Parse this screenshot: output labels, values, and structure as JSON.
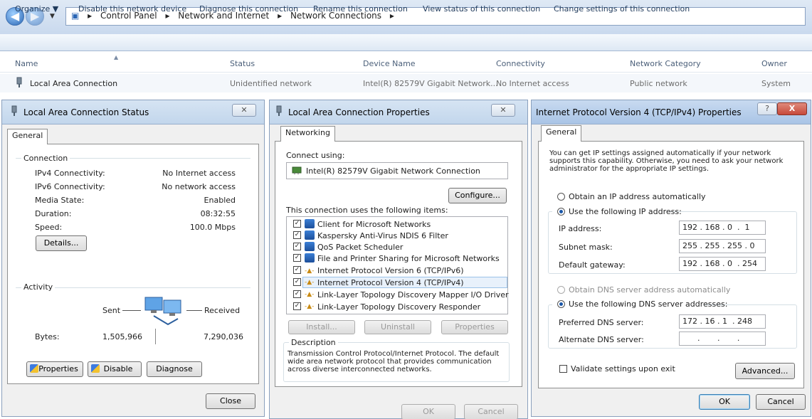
{
  "window": {
    "breadcrumbs": [
      "Control Panel",
      "Network and Internet",
      "Network Connections"
    ]
  },
  "toolbar": {
    "organize": "Organize ▼",
    "disable": "Disable this network device",
    "diagnose": "Diagnose this connection",
    "rename": "Rename this connection",
    "view_status": "View status of this connection",
    "change_settings": "Change settings of this connection"
  },
  "list": {
    "columns": [
      "Name",
      "Status",
      "Device Name",
      "Connectivity",
      "Network Category",
      "Owner"
    ],
    "rows": [
      [
        "Local Area Connection",
        "Unidentified network",
        "Intel(R) 82579V Gigabit Network...",
        "No Internet access",
        "Public network",
        "System"
      ]
    ]
  },
  "status_dialog": {
    "title": "Local Area Connection Status",
    "tab": "General",
    "connection_group": "Connection",
    "fields": [
      {
        "label": "IPv4 Connectivity:",
        "value": "No Internet access"
      },
      {
        "label": "IPv6 Connectivity:",
        "value": "No network access"
      },
      {
        "label": "Media State:",
        "value": "Enabled"
      },
      {
        "label": "Duration:",
        "value": "08:32:55"
      },
      {
        "label": "Speed:",
        "value": "100.0 Mbps"
      }
    ],
    "details_btn": "Details...",
    "activity_group": "Activity",
    "sent": "Sent",
    "received": "Received",
    "bytes_label": "Bytes:",
    "bytes_sent": "1,505,966",
    "bytes_received": "7,290,036",
    "properties_btn": "Properties",
    "disable_btn": "Disable",
    "diagnose_btn": "Diagnose",
    "close_btn": "Close"
  },
  "props_dialog": {
    "title": "Local Area Connection Properties",
    "tab": "Networking",
    "connect_using": "Connect using:",
    "adapter": "Intel(R) 82579V Gigabit Network Connection",
    "configure_btn": "Configure...",
    "items_label": "This connection uses the following items:",
    "items": [
      "Client for Microsoft Networks",
      "Kaspersky Anti-Virus NDIS 6 Filter",
      "QoS Packet Scheduler",
      "File and Printer Sharing for Microsoft Networks",
      "Internet Protocol Version 6 (TCP/IPv6)",
      "Internet Protocol Version 4 (TCP/IPv4)",
      "Link-Layer Topology Discovery Mapper I/O Driver",
      "Link-Layer Topology Discovery Responder"
    ],
    "install_btn": "Install...",
    "uninstall_btn": "Uninstall",
    "properties_btn": "Properties",
    "description_label": "Description",
    "description": "Transmission Control Protocol/Internet Protocol. The default wide area network protocol that provides communication across diverse interconnected networks.",
    "ok_btn": "OK",
    "cancel_btn": "Cancel"
  },
  "ipv4_dialog": {
    "title": "Internet Protocol Version 4 (TCP/IPv4) Properties",
    "help_btn": "?",
    "close_btn": "X",
    "tab": "General",
    "intro": "You can get IP settings assigned automatically if your network supports this capability. Otherwise, you need to ask your network administrator for the appropriate IP settings.",
    "obtain_ip_auto": "Obtain an IP address automatically",
    "use_following_ip": "Use the following IP address:",
    "ip_label": "IP address:",
    "ip_value": "192 . 168 . 0  .  1",
    "subnet_label": "Subnet mask:",
    "subnet_value": "255 . 255 . 255 . 0",
    "gateway_label": "Default gateway:",
    "gateway_value": "192 . 168 . 0  . 254",
    "obtain_dns_auto": "Obtain DNS server address automatically",
    "use_following_dns": "Use the following DNS server addresses:",
    "preferred_label": "Preferred DNS server:",
    "preferred_value": "172 . 16 . 1  . 248",
    "alternate_label": "Alternate DNS server:",
    "alternate_value": "      .       .       .",
    "validate_label": "Validate settings upon exit",
    "advanced_btn": "Advanced...",
    "ok_btn": "OK",
    "cancel_btn": "Cancel"
  },
  "colors": {
    "accent": "#1a57a8",
    "close_red": "#c7493a"
  }
}
